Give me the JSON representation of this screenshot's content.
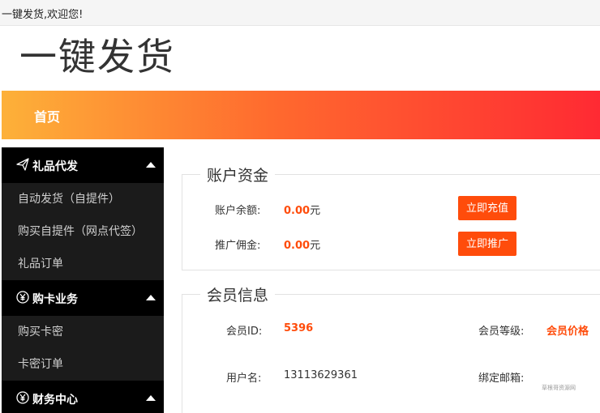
{
  "topbar": {
    "welcome": "一键发货,欢迎您!"
  },
  "logo": {
    "text": "一键发货"
  },
  "nav": {
    "home": "首页"
  },
  "sidebar": {
    "groups": [
      {
        "icon": "paper-plane-icon",
        "label": "礼品代发",
        "items": [
          "自动发货（自提件）",
          "购买自提件（网点代签）",
          "礼品订单"
        ]
      },
      {
        "icon": "yen-circle-icon",
        "label": "购卡业务",
        "items": [
          "购买卡密",
          "卡密订单"
        ]
      },
      {
        "icon": "yen-circle-icon",
        "label": "财务中心",
        "items": []
      }
    ]
  },
  "fund": {
    "title": "账户资金",
    "balance_label": "账户余额:",
    "balance_value": "0.00",
    "balance_unit": "元",
    "recharge_button": "立即充值",
    "commission_label": "推广佣金:",
    "commission_value": "0.00",
    "commission_unit": "元",
    "promote_button": "立即推广"
  },
  "member": {
    "title": "会员信息",
    "id_label": "会员ID:",
    "id_value": "5396",
    "level_label": "会员等级:",
    "level_value": "会员价格",
    "username_label": "用户名:",
    "username_value": "13113629361",
    "email_label": "绑定邮箱:"
  },
  "watermark": "草根哥资源网",
  "colors": {
    "accent": "#ff4c0b",
    "sidebar_bg": "#1b1b1b",
    "sidebar_head_bg": "#000000",
    "nav_start": "#fdb139",
    "nav_end": "#ff2a33"
  }
}
